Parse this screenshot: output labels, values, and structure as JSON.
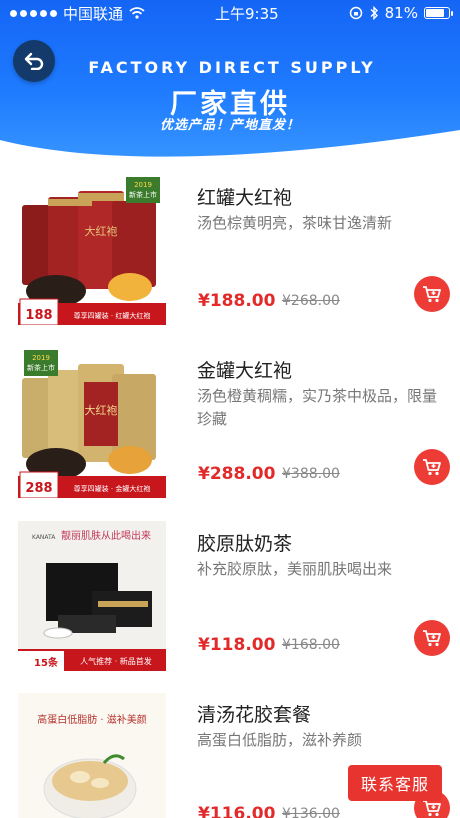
{
  "status_bar": {
    "carrier": "中国联通",
    "time": "上午9:35",
    "battery": "81%",
    "battery_level": 0.81
  },
  "banner": {
    "title_en": "FACTORY DIRECT SUPPLY",
    "title_cn": "厂家直供",
    "subtitle": "优选产品！产地直发！"
  },
  "products": [
    {
      "title": "红罐大红袍",
      "desc": "汤色棕黄明亮，茶味甘逸清新",
      "price": "¥188.00",
      "old_price": "¥268.00",
      "thumb": {
        "badge_year": "2019",
        "badge_text": "新茶上市",
        "price_tag": "188",
        "bar_text": "尊享四罐装 · 红罐大红袍"
      }
    },
    {
      "title": "金罐大红袍",
      "desc": "汤色橙黄稠糯，实乃茶中极品，限量珍藏",
      "price": "¥288.00",
      "old_price": "¥388.00",
      "thumb": {
        "badge_year": "2019",
        "badge_text": "新茶上市",
        "price_tag": "288",
        "bar_text": "尊享四罐装 · 金罐大红袍"
      }
    },
    {
      "title": "胶原肽奶茶",
      "desc": "补充胶原肽，美丽肌肤喝出来",
      "price": "¥118.00",
      "old_price": "¥168.00",
      "thumb": {
        "brand": "KANATA",
        "headline": "靓丽肌肤从此喝出来",
        "price_tag": "15条",
        "bar_text": "人气推荐 · 新品首发"
      }
    },
    {
      "title": "清汤花胶套餐",
      "desc": "高蛋白低脂肪，滋补养颜",
      "price": "¥116.00",
      "old_price": "¥136.00",
      "thumb": {
        "headline": "高蛋白低脂肪 · 滋补美颜"
      }
    }
  ],
  "service_button": "联系客服",
  "colors": {
    "accent_red": "#e7342f",
    "banner_blue": "#1f7cff",
    "back_button": "#143a6b"
  }
}
